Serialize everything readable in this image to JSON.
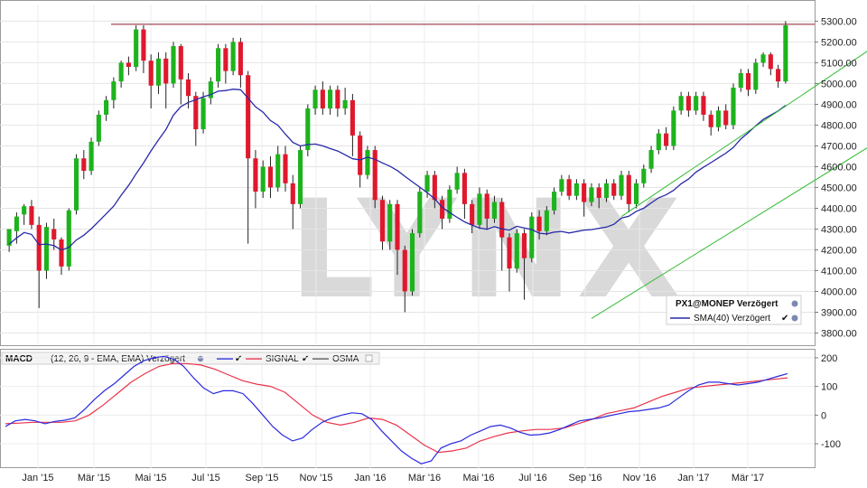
{
  "chart_data": [
    {
      "type": "candlestick",
      "watermark": "LYNX",
      "y_ticks": [
        "5300.00",
        "5200.00",
        "5100.00",
        "5000.00",
        "4900.00",
        "4800.00",
        "4700.00",
        "4600.00",
        "4500.00",
        "4400.00",
        "4300.00",
        "4200.00",
        "4100.00",
        "4000.00",
        "3900.00",
        "3800.00"
      ],
      "ylim": [
        3750,
        5380
      ],
      "x_labels": [
        "Jan '15",
        "Mär '15",
        "Mai '15",
        "Jul '15",
        "Sep '15",
        "Nov '15",
        "Jan '16",
        "Mär '16",
        "Mai '16",
        "Jul '16",
        "Sep '16",
        "Nov '16",
        "Jan '17",
        "Mär '17"
      ],
      "resistance_level": 5285,
      "trend_channel": {
        "upper": [
          [
            82,
            4360
          ],
          [
            123,
            5350
          ]
        ],
        "lower": [
          [
            78,
            3870
          ],
          [
            123,
            4870
          ]
        ]
      },
      "legend": {
        "symbol": "PX1@MONEP Verzögert",
        "sma_label": "SMA(40) Verzögert"
      },
      "colors": {
        "up": "#1db31d",
        "down": "#e0182d",
        "sma": "#2929a8",
        "channel": "#33bb33",
        "resistance": "#8b1a2b"
      },
      "candles": [
        [
          4220,
          4300,
          4190,
          4290
        ],
        [
          4290,
          4360,
          4230,
          4380
        ],
        [
          4370,
          4410,
          4320,
          4420
        ],
        [
          4410,
          4320,
          4300,
          4440
        ],
        [
          4320,
          4100,
          3920,
          4360
        ],
        [
          4100,
          4310,
          4060,
          4330
        ],
        [
          4300,
          4250,
          4200,
          4350
        ],
        [
          4250,
          4120,
          4080,
          4260
        ],
        [
          4120,
          4390,
          4100,
          4400
        ],
        [
          4390,
          4640,
          4370,
          4660
        ],
        [
          4640,
          4580,
          4540,
          4680
        ],
        [
          4580,
          4720,
          4560,
          4740
        ],
        [
          4720,
          4850,
          4700,
          4870
        ],
        [
          4850,
          4920,
          4820,
          4940
        ],
        [
          4920,
          5010,
          4880,
          5030
        ],
        [
          5010,
          5100,
          4980,
          5110
        ],
        [
          5100,
          5080,
          5040,
          5130
        ],
        [
          5080,
          5260,
          5060,
          5280
        ],
        [
          5260,
          5110,
          5050,
          5280
        ],
        [
          5110,
          4990,
          4880,
          5140
        ],
        [
          4990,
          5120,
          4950,
          5150
        ],
        [
          5120,
          5000,
          4880,
          5150
        ],
        [
          5000,
          5180,
          4980,
          5200
        ],
        [
          5180,
          5020,
          4900,
          5190
        ],
        [
          5020,
          4940,
          4880,
          5050
        ],
        [
          4940,
          4780,
          4700,
          4960
        ],
        [
          4780,
          4930,
          4760,
          4960
        ],
        [
          4930,
          5010,
          4900,
          5030
        ],
        [
          5010,
          5170,
          4980,
          5190
        ],
        [
          5170,
          5060,
          5000,
          5190
        ],
        [
          5060,
          5200,
          5040,
          5220
        ],
        [
          5200,
          5040,
          4980,
          5220
        ],
        [
          5040,
          4640,
          4230,
          5060
        ],
        [
          4640,
          4480,
          4400,
          4680
        ],
        [
          4480,
          4600,
          4450,
          4630
        ],
        [
          4600,
          4500,
          4450,
          4650
        ],
        [
          4500,
          4660,
          4480,
          4700
        ],
        [
          4660,
          4520,
          4480,
          4700
        ],
        [
          4520,
          4420,
          4300,
          4560
        ],
        [
          4420,
          4680,
          4400,
          4700
        ],
        [
          4680,
          4880,
          4650,
          4900
        ],
        [
          4880,
          4970,
          4850,
          4990
        ],
        [
          4970,
          4880,
          4850,
          5010
        ],
        [
          4880,
          4970,
          4850,
          4990
        ],
        [
          4970,
          4880,
          4840,
          4990
        ],
        [
          4880,
          4920,
          4850,
          4980
        ],
        [
          4920,
          4750,
          4650,
          4950
        ],
        [
          4750,
          4560,
          4500,
          4770
        ],
        [
          4560,
          4680,
          4540,
          4700
        ],
        [
          4680,
          4440,
          4400,
          4700
        ],
        [
          4440,
          4240,
          4200,
          4460
        ],
        [
          4240,
          4420,
          4200,
          4440
        ],
        [
          4420,
          4200,
          4080,
          4440
        ],
        [
          4200,
          4000,
          3900,
          4220
        ],
        [
          4000,
          4280,
          3980,
          4300
        ],
        [
          4280,
          4480,
          4260,
          4500
        ],
        [
          4480,
          4560,
          4450,
          4580
        ],
        [
          4560,
          4440,
          4400,
          4580
        ],
        [
          4440,
          4350,
          4300,
          4460
        ],
        [
          4350,
          4490,
          4330,
          4510
        ],
        [
          4490,
          4570,
          4470,
          4600
        ],
        [
          4570,
          4420,
          4350,
          4590
        ],
        [
          4420,
          4320,
          4280,
          4440
        ],
        [
          4320,
          4470,
          4300,
          4500
        ],
        [
          4470,
          4350,
          4300,
          4490
        ],
        [
          4350,
          4430,
          4330,
          4460
        ],
        [
          4430,
          4260,
          4100,
          4450
        ],
        [
          4260,
          4110,
          4000,
          4280
        ],
        [
          4110,
          4280,
          4090,
          4300
        ],
        [
          4280,
          4160,
          3960,
          4300
        ],
        [
          4160,
          4360,
          4140,
          4380
        ],
        [
          4360,
          4290,
          4250,
          4390
        ],
        [
          4290,
          4390,
          4270,
          4410
        ],
        [
          4390,
          4480,
          4370,
          4500
        ],
        [
          4480,
          4540,
          4460,
          4560
        ],
        [
          4540,
          4460,
          4440,
          4560
        ],
        [
          4460,
          4520,
          4440,
          4540
        ],
        [
          4520,
          4430,
          4360,
          4540
        ],
        [
          4430,
          4500,
          4410,
          4520
        ],
        [
          4500,
          4450,
          4400,
          4520
        ],
        [
          4450,
          4520,
          4430,
          4540
        ],
        [
          4520,
          4460,
          4440,
          4540
        ],
        [
          4460,
          4560,
          4440,
          4580
        ],
        [
          4560,
          4420,
          4380,
          4580
        ],
        [
          4420,
          4520,
          4400,
          4540
        ],
        [
          4520,
          4590,
          4500,
          4610
        ],
        [
          4590,
          4680,
          4570,
          4700
        ],
        [
          4680,
          4760,
          4660,
          4780
        ],
        [
          4760,
          4700,
          4680,
          4790
        ],
        [
          4700,
          4870,
          4680,
          4890
        ],
        [
          4870,
          4940,
          4850,
          4960
        ],
        [
          4940,
          4870,
          4840,
          4960
        ],
        [
          4870,
          4940,
          4850,
          4960
        ],
        [
          4940,
          4850,
          4820,
          4960
        ],
        [
          4850,
          4790,
          4750,
          4870
        ],
        [
          4790,
          4870,
          4770,
          4890
        ],
        [
          4870,
          4800,
          4780,
          4900
        ],
        [
          4800,
          4980,
          4780,
          5000
        ],
        [
          4980,
          5050,
          4960,
          5070
        ],
        [
          5050,
          4970,
          4940,
          5070
        ],
        [
          4970,
          5100,
          4950,
          5120
        ],
        [
          5100,
          5140,
          5080,
          5150
        ],
        [
          5140,
          5070,
          5040,
          5150
        ],
        [
          5070,
          5010,
          4980,
          5090
        ],
        [
          5010,
          5280,
          5000,
          5300
        ]
      ]
    },
    {
      "type": "line",
      "panel": "MACD",
      "title": "MACD",
      "params": "(12, 26, 9 - EMA, EMA) Verzögert",
      "y_ticks": [
        "200",
        "100",
        "0",
        "-100"
      ],
      "ylim": [
        -185,
        225
      ],
      "series": [
        {
          "name": "",
          "color": "#2a2ae0"
        },
        {
          "name": "SIGNAL",
          "color": "#e8344a"
        },
        {
          "name": "OSMA",
          "color": "#555555"
        }
      ],
      "macd_values": [
        -40,
        -20,
        -15,
        -20,
        -30,
        -22,
        -18,
        -10,
        20,
        55,
        85,
        110,
        140,
        170,
        190,
        200,
        205,
        195,
        170,
        130,
        95,
        75,
        85,
        85,
        75,
        40,
        0,
        -40,
        -70,
        -90,
        -80,
        -50,
        -25,
        -10,
        0,
        8,
        5,
        -15,
        -55,
        -90,
        -125,
        -150,
        -170,
        -160,
        -115,
        -100,
        -90,
        -70,
        -55,
        -40,
        -35,
        -45,
        -60,
        -70,
        -68,
        -62,
        -50,
        -35,
        -20,
        -15,
        -10,
        -2,
        5,
        12,
        15,
        20,
        25,
        35,
        60,
        85,
        105,
        115,
        115,
        110,
        105,
        110,
        115,
        125,
        135,
        145
      ],
      "signal_values": [
        -30,
        -28,
        -25,
        -25,
        -25,
        -20,
        0,
        35,
        75,
        115,
        145,
        170,
        180,
        180,
        175,
        160,
        140,
        120,
        108,
        100,
        80,
        40,
        0,
        -25,
        -35,
        -25,
        -10,
        -15,
        -35,
        -70,
        -105,
        -130,
        -125,
        -115,
        -90,
        -75,
        -62,
        -55,
        -50,
        -50,
        -45,
        -30,
        -15,
        5,
        15,
        25,
        45,
        65,
        80,
        95,
        100,
        105,
        110,
        115,
        120,
        125,
        130
      ]
    }
  ]
}
